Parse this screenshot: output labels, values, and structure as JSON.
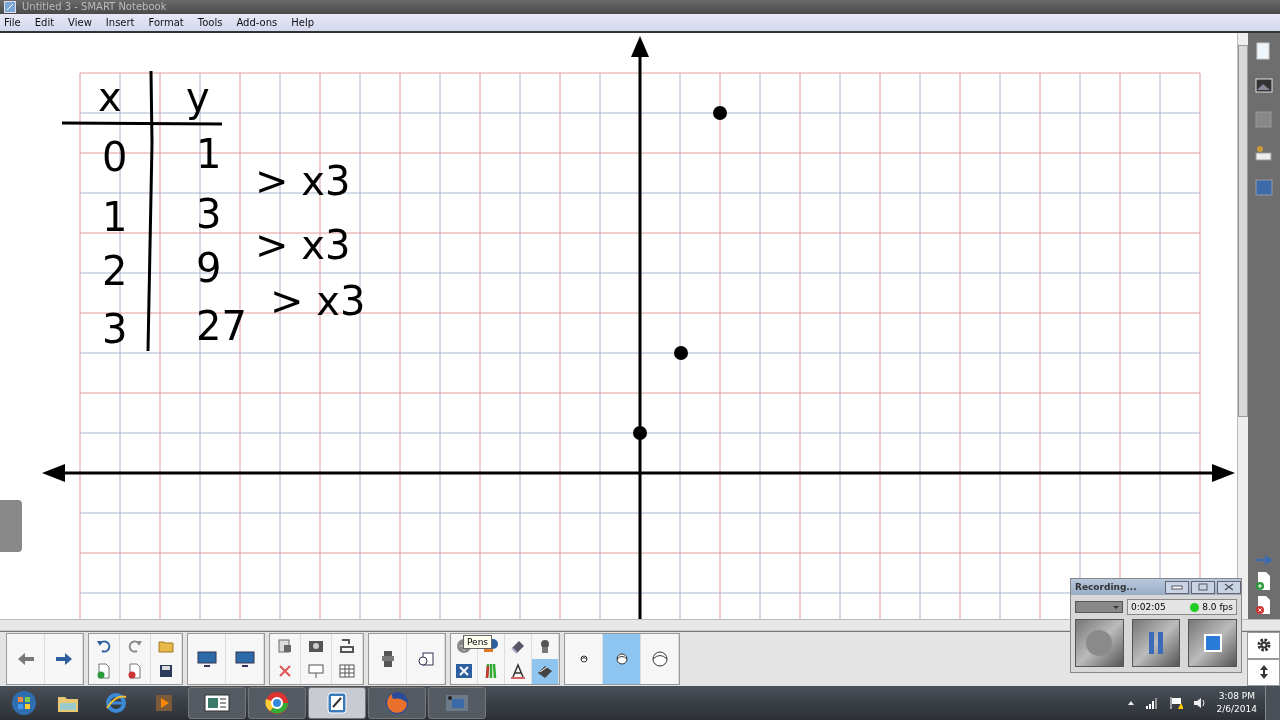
{
  "window": {
    "title": "Untitled 3 - SMART Notebook"
  },
  "menu": [
    "File",
    "Edit",
    "View",
    "Insert",
    "Format",
    "Tools",
    "Add-ons",
    "Help"
  ],
  "whiteboard": {
    "table_headers": [
      "x",
      "y"
    ],
    "table_rows": [
      [
        "0",
        "1"
      ],
      [
        "1",
        "3"
      ],
      [
        "2",
        "9"
      ],
      [
        "3",
        "27"
      ]
    ],
    "ratios": [
      "> x3",
      "> x3",
      "> x3"
    ]
  },
  "toolbar": {
    "tooltip": "Pens",
    "drawing_tools": [
      {
        "selected": false
      },
      {
        "selected": false
      },
      {
        "selected": false
      },
      {
        "selected": false
      },
      {
        "selected": false
      },
      {
        "selected": false
      },
      {
        "selected": false
      },
      {
        "selected": true
      }
    ],
    "width_options": [
      {
        "selected": false
      },
      {
        "selected": true
      },
      {
        "selected": false
      }
    ]
  },
  "recorder": {
    "title": "Recording...",
    "elapsed": "0:02:05",
    "recording": true,
    "frame_rate": "8.0 fps"
  },
  "taskbar": {
    "apps": [
      {
        "selected": false
      },
      {
        "selected": false
      },
      {
        "selected": false
      },
      {
        "selected": false
      },
      {
        "selected": false
      },
      {
        "selected": true
      },
      {
        "selected": false
      },
      {
        "selected": false
      }
    ],
    "time": "3:08 PM",
    "date": "2/6/2014"
  }
}
